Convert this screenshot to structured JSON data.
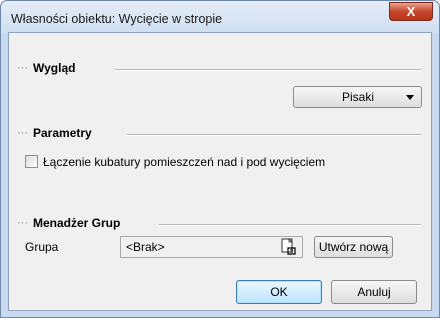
{
  "window": {
    "title": "Własności obiektu: Wycięcie w stropie",
    "close_symbol": "X"
  },
  "sections": {
    "appearance": {
      "dots": "···",
      "header": "Wygląd",
      "pens_button": "Pisaki"
    },
    "parameters": {
      "dots": "···",
      "header": "Parametry",
      "checkbox_label": "Łączenie kubatury pomieszczeń nad i pod wycięciem",
      "checkbox_checked": false
    },
    "group_manager": {
      "dots": "···",
      "header": "Menadżer Grup",
      "group_label": "Grupa",
      "group_value": "<Brak>",
      "create_new_button": "Utwórz nową"
    }
  },
  "footer": {
    "ok_button": "OK",
    "cancel_button": "Anuluj"
  },
  "icons": {
    "close": "close-icon",
    "dropdown": "dropdown-arrow-icon",
    "select_group": "document-select-icon"
  }
}
